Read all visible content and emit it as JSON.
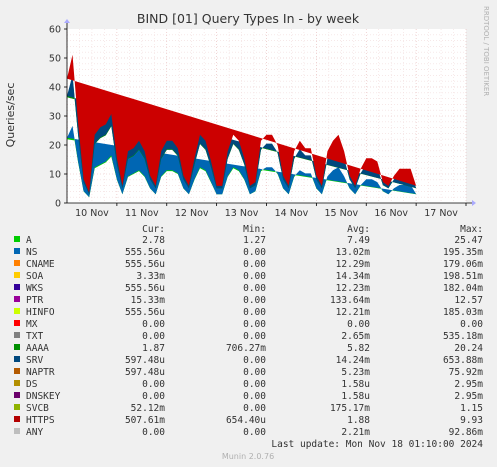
{
  "chart_data": {
    "type": "area",
    "title": "BIND [01] Query Types In - by week",
    "ylabel": "Queries/sec",
    "side_label": "RRDTOOL / TOBI OETIKER",
    "ylim": [
      0,
      60
    ],
    "yticks": [
      0,
      10,
      20,
      30,
      40,
      50,
      60
    ],
    "xticks": [
      "10 Nov",
      "11 Nov",
      "12 Nov",
      "13 Nov",
      "14 Nov",
      "15 Nov",
      "16 Nov",
      "17 Nov"
    ],
    "grid": true,
    "x": [
      "Nov 9 00:00",
      "Nov 9 03:00",
      "Nov 9 06:00",
      "Nov 9 09:00",
      "Nov 9 12:00",
      "Nov 9 15:00",
      "Nov 9 18:00",
      "Nov 9 21:00",
      "Nov 10 00:00",
      "Nov 10 03:00",
      "Nov 10 06:00",
      "Nov 10 09:00",
      "Nov 10 12:00",
      "Nov 10 15:00",
      "Nov 10 18:00",
      "Nov 10 21:00",
      "Nov 11 00:00",
      "Nov 11 03:00",
      "Nov 11 06:00",
      "Nov 11 09:00",
      "Nov 11 12:00",
      "Nov 11 15:00",
      "Nov 11 18:00",
      "Nov 11 21:00",
      "Nov 12 00:00",
      "Nov 12 03:00",
      "Nov 12 06:00",
      "Nov 12 09:00",
      "Nov 12 12:00",
      "Nov 12 15:00",
      "Nov 12 18:00",
      "Nov 12 21:00",
      "Nov 13 00:00",
      "Nov 13 03:00",
      "Nov 13 06:00",
      "Nov 13 09:00",
      "Nov 13 12:00",
      "Nov 13 15:00",
      "Nov 13 18:00",
      "Nov 13 21:00",
      "Nov 14 00:00",
      "Nov 14 03:00",
      "Nov 14 06:00",
      "Nov 14 09:00",
      "Nov 14 12:00",
      "Nov 14 15:00",
      "Nov 14 18:00",
      "Nov 14 21:00",
      "Nov 15 00:00",
      "Nov 15 03:00",
      "Nov 15 06:00",
      "Nov 15 09:00",
      "Nov 15 12:00",
      "Nov 15 15:00",
      "Nov 15 18:00",
      "Nov 15 21:00",
      "Nov 16 00:00",
      "Nov 16 03:00",
      "Nov 16 06:00",
      "Nov 16 09:00",
      "Nov 16 12:00",
      "Nov 16 15:00",
      "Nov 16 18:00",
      "Nov 16 21:00",
      "Nov 17 00:00",
      "Nov 17 03:00",
      "Nov 17 06:00",
      "Nov 17 09:00",
      "Nov 17 12:00",
      "Nov 17 15:00",
      "Nov 17 18:00",
      "Nov 17 21:00",
      "Nov 18 00:00"
    ],
    "series": [
      {
        "name": "A",
        "color": "#00cc00",
        "values": [
          22,
          26,
          14,
          4,
          2,
          12,
          13,
          14,
          16,
          8,
          3,
          9,
          10,
          11,
          9,
          5,
          3,
          9,
          11,
          11,
          10,
          5,
          3,
          8,
          12,
          11,
          7,
          3,
          3,
          9,
          12,
          11,
          8,
          3,
          4,
          11,
          12,
          12,
          10,
          5,
          3,
          9,
          11,
          10,
          10,
          5,
          3,
          9,
          11,
          12,
          9,
          5,
          3,
          6,
          8,
          8,
          7,
          4,
          3,
          5,
          6,
          6,
          6,
          3
        ]
      },
      {
        "name": "NS",
        "color": "#0066b3",
        "values": [
          0.5,
          0.6,
          0.3,
          0.1,
          0.05,
          0.3,
          0.3,
          0.3,
          0.4,
          0.2,
          0.05,
          0.2,
          0.2,
          0.3,
          0.2,
          0.1,
          0.05,
          0.2,
          0.3,
          0.3,
          0.2,
          0.1,
          0.05,
          0.2,
          0.3,
          0.3,
          0.2,
          0.05,
          0.05,
          0.2,
          0.3,
          0.3,
          0.2,
          0.05,
          0.1,
          0.3,
          0.3,
          0.3,
          0.2,
          0.1,
          0.05,
          0.2,
          0.3,
          0.2,
          0.2,
          0.1,
          0.05,
          0.2,
          0.3,
          0.3,
          0.2,
          0.1,
          0.05,
          0.2,
          0.2,
          0.2,
          0.2,
          0.1,
          0.05,
          0.1,
          0.2,
          0.2,
          0.2,
          0.1
        ]
      },
      {
        "name": "AAAA",
        "color": "#008f00",
        "values": [
          14,
          17,
          9,
          3,
          1,
          8,
          9,
          9,
          10,
          5,
          2,
          6,
          6,
          7,
          6,
          3,
          2,
          6,
          7,
          7,
          6,
          3,
          2,
          5,
          8,
          7,
          5,
          2,
          2,
          6,
          8,
          7,
          5,
          2,
          2,
          7,
          8,
          8,
          7,
          3,
          2,
          6,
          7,
          6,
          6,
          3,
          2,
          6,
          7,
          8,
          6,
          3,
          2,
          4,
          5,
          5,
          5,
          2,
          2,
          3,
          4,
          4,
          4,
          2
        ]
      },
      {
        "name": "SRV",
        "color": "#00487d",
        "values": [
          0.4,
          0.5,
          0.3,
          0.1,
          0.05,
          0.2,
          0.3,
          0.3,
          0.3,
          0.2,
          0.05,
          0.2,
          0.2,
          0.2,
          0.2,
          0.1,
          0.05,
          0.2,
          0.2,
          0.2,
          0.2,
          0.1,
          0.05,
          0.2,
          0.2,
          0.2,
          0.1,
          0.05,
          0.05,
          0.2,
          0.2,
          0.2,
          0.2,
          0.05,
          0.1,
          0.2,
          0.2,
          0.2,
          0.2,
          0.1,
          0.05,
          0.2,
          0.2,
          0.2,
          0.2,
          0.1,
          0.05,
          0.2,
          0.2,
          0.2,
          0.2,
          0.1,
          0.05,
          0.1,
          0.2,
          0.2,
          0.1,
          0.1,
          0.05,
          0.1,
          0.1,
          0.1,
          0.1,
          0.05
        ]
      },
      {
        "name": "HTTPS",
        "color": "#cc0000",
        "values": [
          6,
          7,
          4,
          1,
          0.5,
          3,
          3.5,
          3.5,
          4,
          2,
          0.8,
          2.5,
          2.5,
          3,
          2.5,
          1.2,
          0.8,
          2.5,
          3,
          3,
          2.5,
          1.2,
          0.8,
          2,
          3,
          3,
          2,
          0.8,
          0.8,
          2.5,
          3,
          3,
          2,
          0.8,
          1,
          3,
          3,
          3,
          2.5,
          1.2,
          0.8,
          2.5,
          3,
          2.5,
          2.5,
          1.2,
          0.8,
          2.5,
          3,
          3,
          2.5,
          1.2,
          0.8,
          1.5,
          2,
          2,
          2,
          1,
          0.8,
          1.2,
          1.5,
          1.5,
          1.5,
          0.8
        ]
      }
    ],
    "legend": {
      "headers": [
        "Cur:",
        "Min:",
        "Avg:",
        "Max:"
      ],
      "rows": [
        {
          "name": "A",
          "color": "#00cc00",
          "cur": "2.78",
          "min": "1.27",
          "avg": "7.49",
          "max": "25.47"
        },
        {
          "name": "NS",
          "color": "#0066b3",
          "cur": "555.56u",
          "min": "0.00",
          "avg": "13.02m",
          "max": "195.35m"
        },
        {
          "name": "CNAME",
          "color": "#ff8000",
          "cur": "555.56u",
          "min": "0.00",
          "avg": "12.29m",
          "max": "179.06m"
        },
        {
          "name": "SOA",
          "color": "#ffcc00",
          "cur": "3.33m",
          "min": "0.00",
          "avg": "14.34m",
          "max": "198.51m"
        },
        {
          "name": "WKS",
          "color": "#330099",
          "cur": "555.56u",
          "min": "0.00",
          "avg": "12.23m",
          "max": "182.04m"
        },
        {
          "name": "PTR",
          "color": "#990099",
          "cur": "15.33m",
          "min": "0.00",
          "avg": "133.64m",
          "max": "12.57"
        },
        {
          "name": "HINFO",
          "color": "#ccff00",
          "cur": "555.56u",
          "min": "0.00",
          "avg": "12.21m",
          "max": "185.03m"
        },
        {
          "name": "MX",
          "color": "#ff0000",
          "cur": "0.00",
          "min": "0.00",
          "avg": "0.00",
          "max": "0.00"
        },
        {
          "name": "TXT",
          "color": "#808080",
          "cur": "0.00",
          "min": "0.00",
          "avg": "2.65m",
          "max": "535.18m"
        },
        {
          "name": "AAAA",
          "color": "#008f00",
          "cur": "1.87",
          "min": "706.27m",
          "avg": "5.82",
          "max": "20.24"
        },
        {
          "name": "SRV",
          "color": "#00487d",
          "cur": "597.48u",
          "min": "0.00",
          "avg": "14.24m",
          "max": "653.88m"
        },
        {
          "name": "NAPTR",
          "color": "#b35a00",
          "cur": "597.48u",
          "min": "0.00",
          "avg": "5.23m",
          "max": "75.92m"
        },
        {
          "name": "DS",
          "color": "#b38f00",
          "cur": "0.00",
          "min": "0.00",
          "avg": "1.58u",
          "max": "2.95m"
        },
        {
          "name": "DNSKEY",
          "color": "#6b006b",
          "cur": "0.00",
          "min": "0.00",
          "avg": "1.58u",
          "max": "2.95m"
        },
        {
          "name": "SVCB",
          "color": "#8fb300",
          "cur": "52.12m",
          "min": "0.00",
          "avg": "175.17m",
          "max": "1.15"
        },
        {
          "name": "HTTPS",
          "color": "#b30000",
          "cur": "507.61m",
          "min": "654.40u",
          "avg": "1.88",
          "max": "9.93"
        },
        {
          "name": "ANY",
          "color": "#bebebe",
          "cur": "0.00",
          "min": "0.00",
          "avg": "2.21m",
          "max": "92.86m"
        }
      ]
    },
    "last_update": "Last update: Mon Nov 18 01:10:00 2024",
    "footer": "Munin 2.0.76"
  }
}
